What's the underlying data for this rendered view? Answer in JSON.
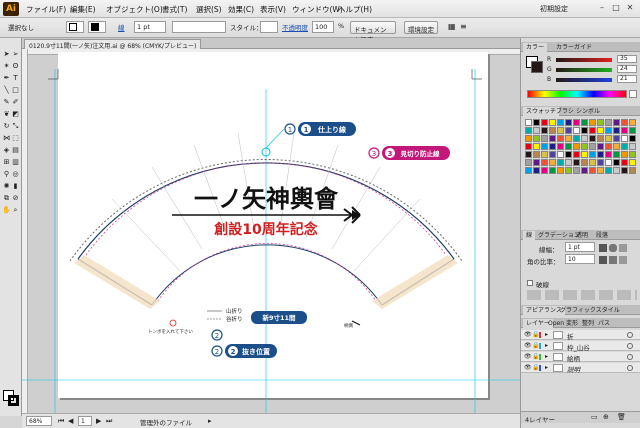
{
  "app": {
    "logo": "Ai"
  },
  "menu": [
    "ファイル(F)",
    "編集(E)",
    "オブジェクト(O)",
    "書式(T)",
    "選択(S)",
    "効果(C)",
    "表示(V)",
    "ウィンドウ(W)",
    "ヘルプ(H)"
  ],
  "workspace": {
    "label": "初期設定"
  },
  "window_controls": [
    "–",
    "□",
    "✕"
  ],
  "control_bar": {
    "selection": "選択なし",
    "stroke_label": "線",
    "stroke_value": "1 pt",
    "style_label": "スタイル：",
    "opacity_label": "不透明度",
    "opacity_value": "100",
    "opacity_unit": "%",
    "doc_settings_button": "ドキュメント設定",
    "env_settings_button": "環境設定"
  },
  "document": {
    "tab_title": "0120.9寸11間(一ノ矢)注文用.ai @ 68% (CMYK/プレビュー)"
  },
  "artwork": {
    "title": "一ノ矢神輿會",
    "subtitle": "創設10周年記念",
    "callout_finish": {
      "num": "1",
      "label": "仕上り線"
    },
    "callout_cut": {
      "num": "3",
      "label": "見切り防止線"
    },
    "callout_offset": {
      "num": "2",
      "label": "抜き位置"
    },
    "size_badge": "新9寸11間",
    "fold_labels": [
      "山折り",
      "谷折り"
    ],
    "tombo_note": "トンボを入れて下さい",
    "small_label": "柄側"
  },
  "status": {
    "zoom": "68%",
    "page": "1",
    "info": "管理外のファイル"
  },
  "color_panel": {
    "tabs": [
      "カラー",
      "カラーガイド"
    ],
    "channels": [
      {
        "name": "R",
        "value": "35",
        "color": "#e02020"
      },
      {
        "name": "G",
        "value": "24",
        "color": "#20b020"
      },
      {
        "name": "B",
        "value": "21",
        "color": "#2040e0"
      }
    ]
  },
  "swatch_panel": {
    "tabs": [
      "スウォッチ",
      "ブラシ",
      "シンボル"
    ]
  },
  "stroke_panel": {
    "tabs": [
      "線",
      "グラデーション",
      "透明",
      "段落"
    ],
    "weight_label": "線幅：",
    "weight_value": "1 pt",
    "corner_label": "角の比率：",
    "corner_value": "10",
    "dash_label": "破線"
  },
  "appearance_panel": {
    "tabs": [
      "アピアランス",
      "グラフィックスタイル"
    ]
  },
  "layers_panel": {
    "tabs": [
      "レイヤー",
      "Open",
      "変形",
      "整列",
      "パス"
    ],
    "layers": [
      {
        "name": "折",
        "color": "#e03030"
      },
      {
        "name": "枠_山谷",
        "color": "#30a0e0"
      },
      {
        "name": "絵柄",
        "color": "#30c030"
      },
      {
        "name": "説明",
        "color": "#3050e0"
      }
    ],
    "count_label": "4レイヤー"
  },
  "colors": {
    "accent": "#1c4f8a",
    "magenta": "#c2187a",
    "red": "#d21f1f",
    "cyan": "#00c0e0"
  }
}
